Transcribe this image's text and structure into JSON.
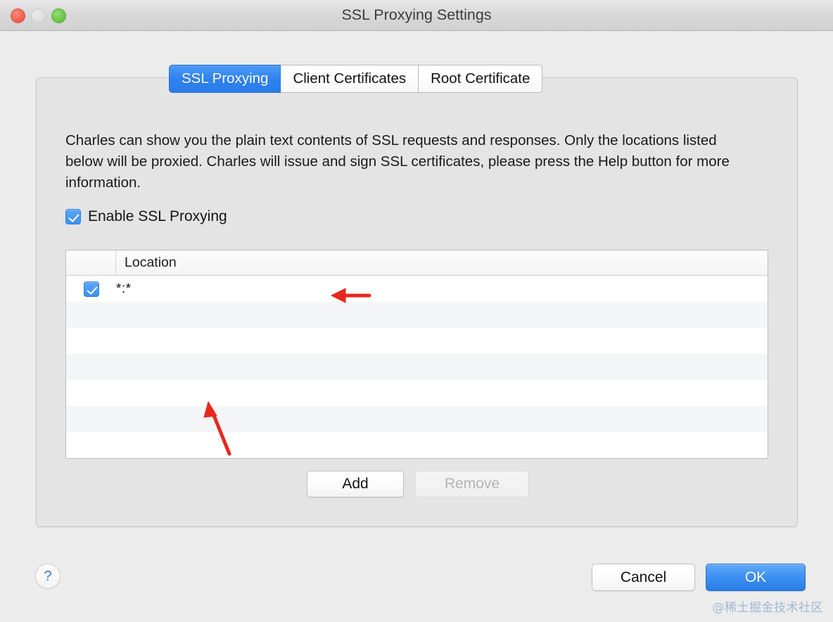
{
  "window": {
    "title": "SSL Proxying Settings",
    "traffic_lights": [
      {
        "name": "close",
        "color": "#ef5f52",
        "enabled": true
      },
      {
        "name": "minimize",
        "color": "#dedede",
        "enabled": false
      },
      {
        "name": "zoom",
        "color": "#6bc54a",
        "enabled": true
      }
    ]
  },
  "tabs": [
    {
      "label": "SSL Proxying",
      "active": true
    },
    {
      "label": "Client Certificates",
      "active": false
    },
    {
      "label": "Root Certificate",
      "active": false
    }
  ],
  "panel": {
    "description": "Charles can show you the plain text contents of SSL requests and responses. Only the locations listed below will be proxied. Charles will issue and sign SSL certificates, please press the Help button for more information.",
    "enable_checkbox": {
      "label": "Enable SSL Proxying",
      "checked": true
    },
    "table": {
      "columns": [
        "",
        "Location"
      ],
      "rows": [
        {
          "checked": true,
          "location": "*:*"
        },
        {
          "checked": false,
          "location": ""
        },
        {
          "checked": false,
          "location": ""
        },
        {
          "checked": false,
          "location": ""
        },
        {
          "checked": false,
          "location": ""
        },
        {
          "checked": false,
          "location": ""
        },
        {
          "checked": false,
          "location": ""
        }
      ]
    },
    "buttons": {
      "add": "Add",
      "remove": "Remove",
      "remove_enabled": false
    }
  },
  "footer": {
    "help": "?",
    "cancel": "Cancel",
    "ok": "OK"
  },
  "annotations": {
    "arrow_color": "#e8271c",
    "arrow_1": "points-left-at-enable-ssl-proxying-checkbox",
    "arrow_2": "points-up-left-at-location-row"
  },
  "watermark": "@稀土掘金技术社区"
}
